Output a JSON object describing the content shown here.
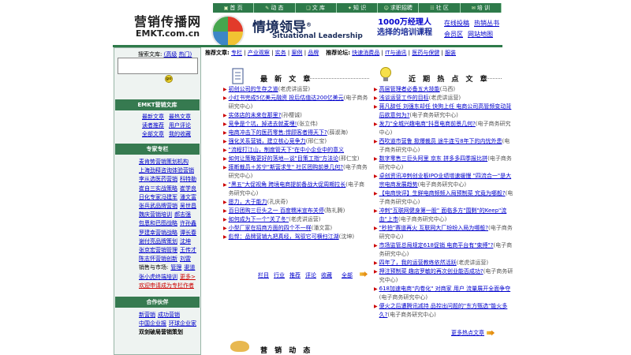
{
  "header": {
    "logo_cn": "营销传播网",
    "logo_en": "EMKT.com.cn",
    "sl_title": "情境领导",
    "sl_reg": "®",
    "sl_sub": "Situational Leadership",
    "promo_line1": "1000万经理人",
    "promo_line2": "选择的培训课程",
    "links": [
      [
        "在线投稿",
        "热销丛书"
      ],
      [
        "会员区",
        "网站地图"
      ]
    ]
  },
  "nav": [
    "首 页",
    "动 态",
    "文 库",
    "知 识",
    "求职招聘",
    "社 区",
    "培 训"
  ],
  "search": {
    "label": "搜索文库:",
    "adv": "(高级",
    "hot": "热门)",
    "go": "go"
  },
  "library": {
    "title": "EMKT营销文库",
    "pairs": [
      [
        "最新文章",
        "最热文章"
      ],
      [
        "读者推荐",
        "用户评论"
      ],
      [
        "全部文章",
        "我的收藏"
      ]
    ]
  },
  "experts": {
    "title": "专家专栏",
    "rows": [
      [
        "麦肯势营销策划机构"
      ],
      [
        "上海劲释咨询体验营销"
      ],
      [
        "李从选医药营销",
        "科特勒"
      ],
      [
        "崔自三实战策略",
        "崔学良"
      ],
      [
        "日化专家冯建军",
        "潘文富"
      ],
      [
        "张兵武品牌营销",
        "吴世昌"
      ],
      [
        "魏庆营销培训",
        "郝志强"
      ],
      [
        "包恩和巴图战略",
        "许孙鑫"
      ],
      [
        "罗建幸营销战略",
        "谭长春"
      ],
      [
        "谢付亮品牌策划",
        "沈坤"
      ],
      [
        "张京宏营销管理",
        "王传才"
      ],
      [
        "陈志怀营销创新",
        "刘雷"
      ]
    ],
    "sales_label": "销售与市场:",
    "sales_links": [
      "管理",
      "渠道"
    ],
    "extra": "张小虎终端培训",
    "more": "更多>",
    "welcome": "欢迎申请成为专栏作者"
  },
  "partners": {
    "title": "合作伙伴",
    "rows": [
      [
        "新营销",
        "成功营销"
      ],
      [
        "中国企业报",
        "环球企业家"
      ]
    ],
    "last": "双剑破局营销策划"
  },
  "recommend": {
    "label1": "推荐文章:",
    "items1": [
      "专栏",
      "产业观察",
      "实务",
      "案例",
      "品牌"
    ],
    "label2": "推荐论坛:",
    "items2": [
      "快速消费品",
      "IT与通讯",
      "医药与保健",
      "服装"
    ]
  },
  "latest": {
    "title": "最 新 文 章",
    "items": [
      {
        "t": "初创公司的生存之道",
        "s": "(老虎讲运营)"
      },
      {
        "t": "小红书完成5亿美元融资 投后估值达200亿美元",
        "s": "(电子商务研究中心)"
      },
      {
        "t": "实体店的未来在那里?",
        "s": "(孙樱诚)"
      },
      {
        "t": "竞争是个坑，掉进去就麦埋!",
        "s": "(张立伟)"
      },
      {
        "t": "电商冲击下的医药零售:悍顾客者得天下?",
        "s": "(薛淑海)"
      },
      {
        "t": "强化关系营销，建立核心竞争力",
        "s": "(邢仁宝)"
      },
      {
        "t": "\"流程打江山，制度管天下\"在中小企业中的意义",
        "s": ""
      },
      {
        "t": "如何让策略更好的落地—谈\"目策工指\"方法论",
        "s": "(邢仁宝)"
      },
      {
        "t": "摔断裁员＋苏宁\"斯营求生\" 社区团购前景几何?",
        "s": "(电子商务研究中心)"
      },
      {
        "t": "\"黑五\"大促视角 跨境电商提前备战大促周期拉长",
        "s": "(电子商务研究中心)"
      },
      {
        "t": "愿力，大于能力",
        "s": "(孔庆奇)"
      },
      {
        "t": "百日团购三巨头之一 百度糯米宣布关停",
        "s": "(陈礼腾)"
      },
      {
        "t": "如何成为下一个\"关了冬\"",
        "s": "(老虎讲运营)"
      },
      {
        "t": "小型厂家在招商方面的四个不一样",
        "s": "(潘文富)"
      },
      {
        "t": "彪悍：品牌营销九把真经，驾驭它可横扫江湖",
        "s": "(沈坤)"
      }
    ],
    "footer": [
      "栏目",
      "行业",
      "推荐",
      "评论",
      "收藏",
      "全部"
    ]
  },
  "hot": {
    "title": "近 期 热 点 文 章",
    "items": [
      {
        "t": "高层管理者必备五大技能",
        "s": "(马西)"
      },
      {
        "t": "浅谈运营工作的目标",
        "s": "(老虎讲运营)"
      },
      {
        "t": "蒋凡辞任 刘强东却任 快狗上任 电商公司高管频变动背后欲意何为?",
        "s": "(电子商务研究中心)"
      },
      {
        "t": "发力\"全城兴趣电商\"抖音电商前景几何?",
        "s": "(电子商务研究中心)"
      },
      {
        "t": "西吹道市营鲁 掀爆裁员 途牛连亏8年下的内忧外患",
        "s": "(电子商务研究中心)"
      },
      {
        "t": "数字零售三巨头阿里 京东 拼多多四季报比拼",
        "s": "(电子商务研究中心)"
      },
      {
        "t": "卓创资讯冲刺创业板IPO业绩增速缓慢 \"四流合一\"是大宗电商发展趋势",
        "s": "(电子商务研究中心)"
      },
      {
        "t": "【电商快评】生鲜电商频频入局预制菜 究竟为哪般?",
        "s": "(电子商务研究中心)"
      },
      {
        "t": "冲刺\"互联网健身第一股\" 面临多方\"围剿\"的Keep\"流血\"上市",
        "s": "(电子商务研究中心)"
      },
      {
        "t": "\"秒拍\"赛道再火 互联网大厂纷纷入局为哪般?",
        "s": "(电子商务研究中心)"
      },
      {
        "t": "市场监管总局规定618促销 电商平台有\"束缚\"?",
        "s": "(电子商务研究中心)"
      },
      {
        "t": "四年了，我的运营教练依然活跃",
        "s": "(老虎讲运营)"
      },
      {
        "t": "押注预制菜 趣店罗敏的再次创业能否成功?",
        "s": "(电子商务研究中心)"
      },
      {
        "t": "618加速电商\"内卷化\" 对商家 用户 流量展开全面争夺",
        "s": "(电子商务研究中心)"
      },
      {
        "t": "便火之后遭腾讯减持 品控出问题的\"东方甄选\"能火多久?",
        "s": "(电子商务研究中心)"
      }
    ],
    "more": "更多热点文章"
  },
  "dynamics": {
    "title": "营 销 动 态"
  },
  "colors": {
    "nav_green": "#2e7a4a",
    "link_blue": "#0000cc",
    "bar_green": "#367a50",
    "panel_bg": "#eef3f1"
  }
}
